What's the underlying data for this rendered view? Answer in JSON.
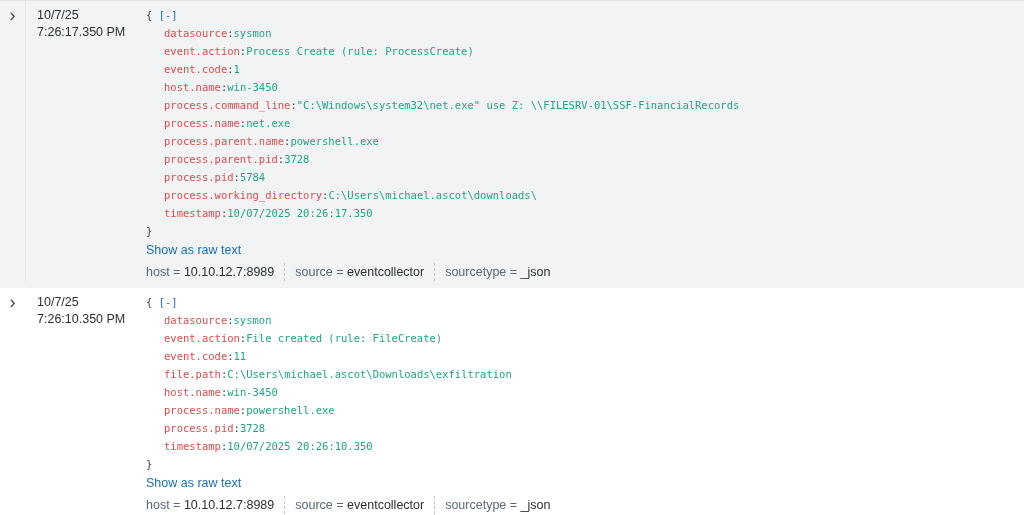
{
  "events": [
    {
      "highlighted": true,
      "toggle": "›",
      "date": "10/7/25",
      "time": "7:26:17.350 PM",
      "separator": ":",
      "open_brace": "{",
      "collapse": "[-]",
      "close_brace": "}",
      "fields": [
        {
          "key": "datasource",
          "value": "sysmon"
        },
        {
          "key": "event.action",
          "value": "Process Create (rule: ProcessCreate)"
        },
        {
          "key": "event.code",
          "value": "1"
        },
        {
          "key": "host.name",
          "value": "win-3450"
        },
        {
          "key": "process.command_line",
          "value": "\"C:\\Windows\\system32\\net.exe\" use Z: \\\\FILESRV-01\\SSF-FinancialRecords"
        },
        {
          "key": "process.name",
          "value": "net.exe"
        },
        {
          "key": "process.parent.name",
          "value": "powershell.exe"
        },
        {
          "key": "process.parent.pid",
          "value": "3728"
        },
        {
          "key": "process.pid",
          "value": "5784"
        },
        {
          "key": "process.working_directory",
          "value": "C:\\Users\\michael.ascot\\downloads\\"
        },
        {
          "key": "timestamp",
          "value": "10/07/2025 20:26:17.350"
        }
      ],
      "raw_link": "Show as raw text",
      "meta": [
        {
          "label": "host =",
          "value": "10.10.12.7:8989"
        },
        {
          "label": "source =",
          "value": "eventcollector"
        },
        {
          "label": "sourcetype =",
          "value": "_json"
        }
      ]
    },
    {
      "highlighted": false,
      "toggle": "›",
      "date": "10/7/25",
      "time": "7:26:10.350 PM",
      "separator": ":",
      "open_brace": "{",
      "collapse": "[-]",
      "close_brace": "}",
      "fields": [
        {
          "key": "datasource",
          "value": "sysmon"
        },
        {
          "key": "event.action",
          "value": "File created (rule: FileCreate)"
        },
        {
          "key": "event.code",
          "value": "11"
        },
        {
          "key": "file.path",
          "value": "C:\\Users\\michael.ascot\\Downloads\\exfiltration"
        },
        {
          "key": "host.name",
          "value": "win-3450"
        },
        {
          "key": "process.name",
          "value": "powershell.exe"
        },
        {
          "key": "process.pid",
          "value": "3728"
        },
        {
          "key": "timestamp",
          "value": "10/07/2025 20:26:10.350"
        }
      ],
      "raw_link": "Show as raw text",
      "meta": [
        {
          "label": "host =",
          "value": "10.10.12.7:8989"
        },
        {
          "label": "source =",
          "value": "eventcollector"
        },
        {
          "label": "sourcetype =",
          "value": "_json"
        }
      ]
    }
  ]
}
